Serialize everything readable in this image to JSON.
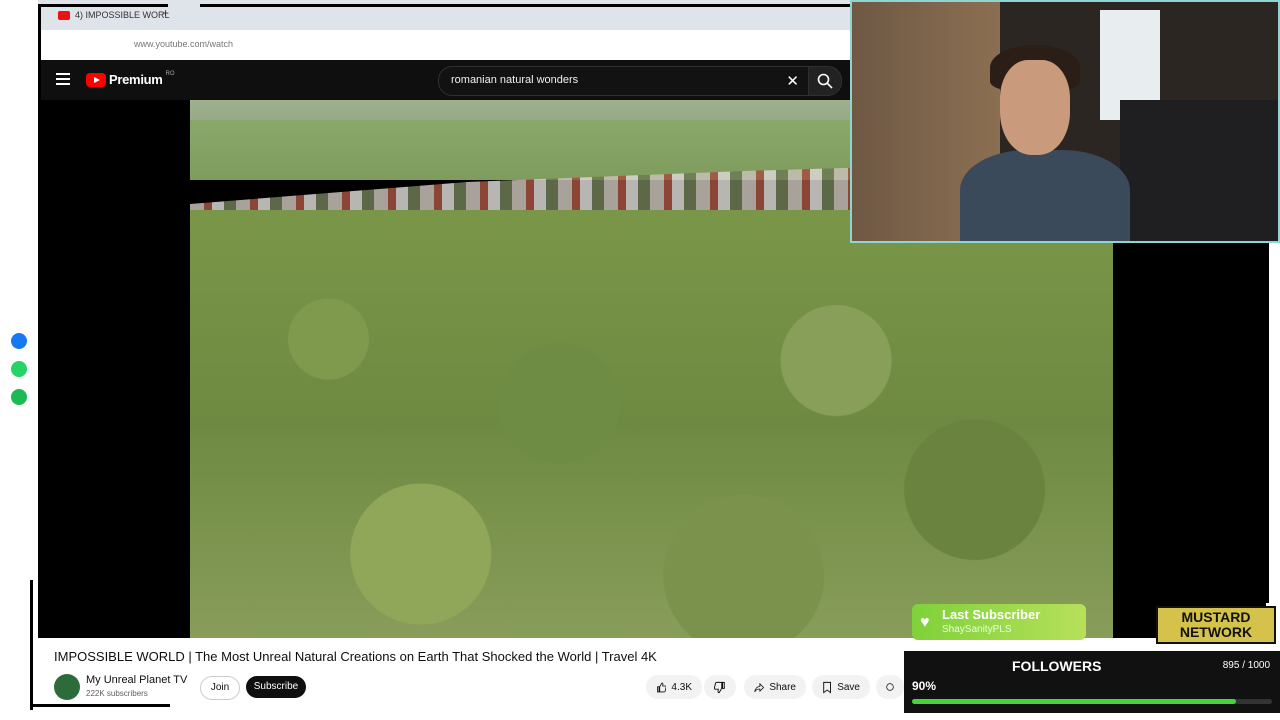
{
  "browser": {
    "tab_title": "4) IMPOSSIBLE WORL",
    "new_tab": "+",
    "url": "www.youtube.com/watch"
  },
  "youtube": {
    "logo_text": "Premium",
    "region": "RO",
    "search_value": "romanian natural wonders"
  },
  "video": {
    "title": "IMPOSSIBLE WORLD | The Most Unreal Natural Creations on Earth That Shocked the World | Travel 4K",
    "channel": "My Unreal Planet TV",
    "subscribers": "222K subscribers",
    "join_label": "Join",
    "subscribe_label": "Subscribe",
    "likes": "4.3K",
    "share_label": "Share",
    "save_label": "Save"
  },
  "stream": {
    "last_subscriber_title": "Last Subscriber",
    "last_subscriber_name": "ShaySanityPLS",
    "network_name": "MUSTARD NETWORK",
    "followers_title": "FOLLOWERS",
    "followers_count": "895 / 1000",
    "followers_percent": "90%",
    "followers_fraction": 0.9,
    "accent": "#47d33a"
  }
}
